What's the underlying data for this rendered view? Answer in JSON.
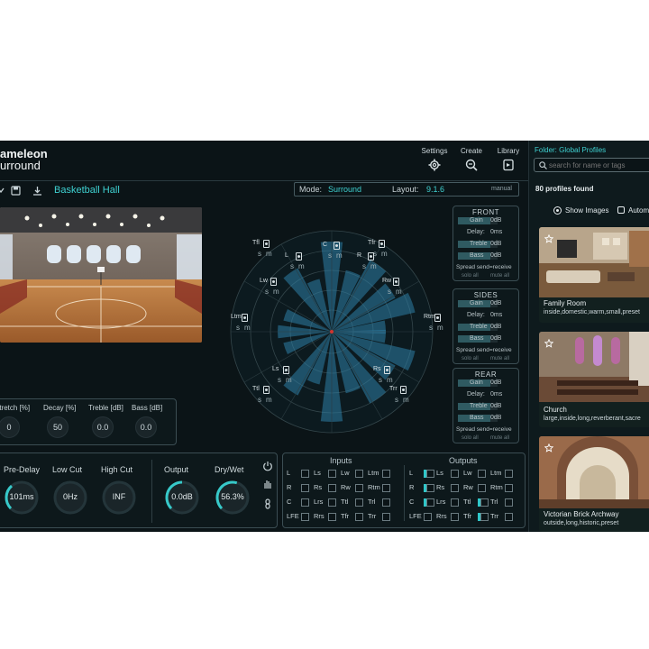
{
  "app": {
    "logo_line1": "ameleon",
    "logo_line2": "urround"
  },
  "nav": {
    "settings": "Settings",
    "create": "Create",
    "library": "Library"
  },
  "preset": {
    "name": "Basketball Hall"
  },
  "modebar": {
    "mode_label": "Mode:",
    "mode_value": "Surround",
    "layout_label": "Layout:",
    "layout_value": "9.1.6",
    "manual": "manual"
  },
  "room_knobs": [
    {
      "label": "Stretch [%]",
      "value": "0"
    },
    {
      "label": "Decay [%]",
      "value": "50"
    },
    {
      "label": "Treble [dB]",
      "value": "0.0"
    },
    {
      "label": "Bass [dB]",
      "value": "0.0"
    }
  ],
  "bottom_knobs": [
    {
      "label": "Pre-Delay",
      "value": "101ms"
    },
    {
      "label": "Low Cut",
      "value": "0Hz"
    },
    {
      "label": "High Cut",
      "value": "INF"
    },
    {
      "label": "Output",
      "value": "0.0dB"
    },
    {
      "label": "Dry/Wet",
      "value": "56.3%"
    }
  ],
  "speakers": [
    {
      "id": "Tfl"
    },
    {
      "id": "C"
    },
    {
      "id": "Tfr"
    },
    {
      "id": "L"
    },
    {
      "id": "R"
    },
    {
      "id": "Lw"
    },
    {
      "id": "Rw"
    },
    {
      "id": "Ltm"
    },
    {
      "id": "Rtm"
    },
    {
      "id": "Ls"
    },
    {
      "id": "Rs"
    },
    {
      "id": "Ttl"
    },
    {
      "id": "Trr"
    }
  ],
  "speaker_buttons": {
    "solo": "s",
    "mute": "m"
  },
  "sections": [
    {
      "title": "FRONT",
      "gain": "Gain",
      "gain_v": "0dB",
      "delay": "Delay:",
      "delay_v": "0ms",
      "treble": "Treble",
      "treble_v": "0dB",
      "bass": "Bass",
      "bass_v": "0dB",
      "spread": "Spread send=receive",
      "solo_all": "solo all",
      "mute_all": "mute all"
    },
    {
      "title": "SIDES",
      "gain": "Gain",
      "gain_v": "0dB",
      "delay": "Delay:",
      "delay_v": "0ms",
      "treble": "Treble",
      "treble_v": "0dB",
      "bass": "Bass",
      "bass_v": "0dB",
      "spread": "Spread send=receive",
      "solo_all": "solo all",
      "mute_all": "mute all"
    },
    {
      "title": "REAR",
      "gain": "Gain",
      "gain_v": "0dB",
      "delay": "Delay:",
      "delay_v": "0ms",
      "treble": "Treble",
      "treble_v": "0dB",
      "bass": "Bass",
      "bass_v": "0dB",
      "spread": "Spread send=receive",
      "solo_all": "solo all",
      "mute_all": "mute all"
    }
  ],
  "io": {
    "inputs_title": "Inputs",
    "outputs_title": "Outputs",
    "rows": [
      [
        "L",
        "Ls",
        "Lw",
        "Ltm"
      ],
      [
        "R",
        "Rs",
        "Rw",
        "Rtm"
      ],
      [
        "C",
        "Lrs",
        "Ttl",
        "Trl"
      ],
      [
        "LFE",
        "Rrs",
        "Tfr",
        "Trr"
      ]
    ]
  },
  "sidebar": {
    "folder": "Folder: Global Profiles",
    "search_placeholder": "search for name or tags",
    "count": "80 profiles found",
    "show_images": "Show Images",
    "auto": "Autom",
    "profiles": [
      {
        "name": "Family Room",
        "tags": "inside,domestic,warm,small,preset"
      },
      {
        "name": "Church",
        "tags": "large,inside,long,reverberant,sacre"
      },
      {
        "name": "Victorian Brick Archway",
        "tags": "outside,long,historic,preset"
      }
    ]
  },
  "colors": {
    "accent": "#3fd1d1",
    "bg": "#0b1417",
    "panel_border": "#3b4d53"
  }
}
